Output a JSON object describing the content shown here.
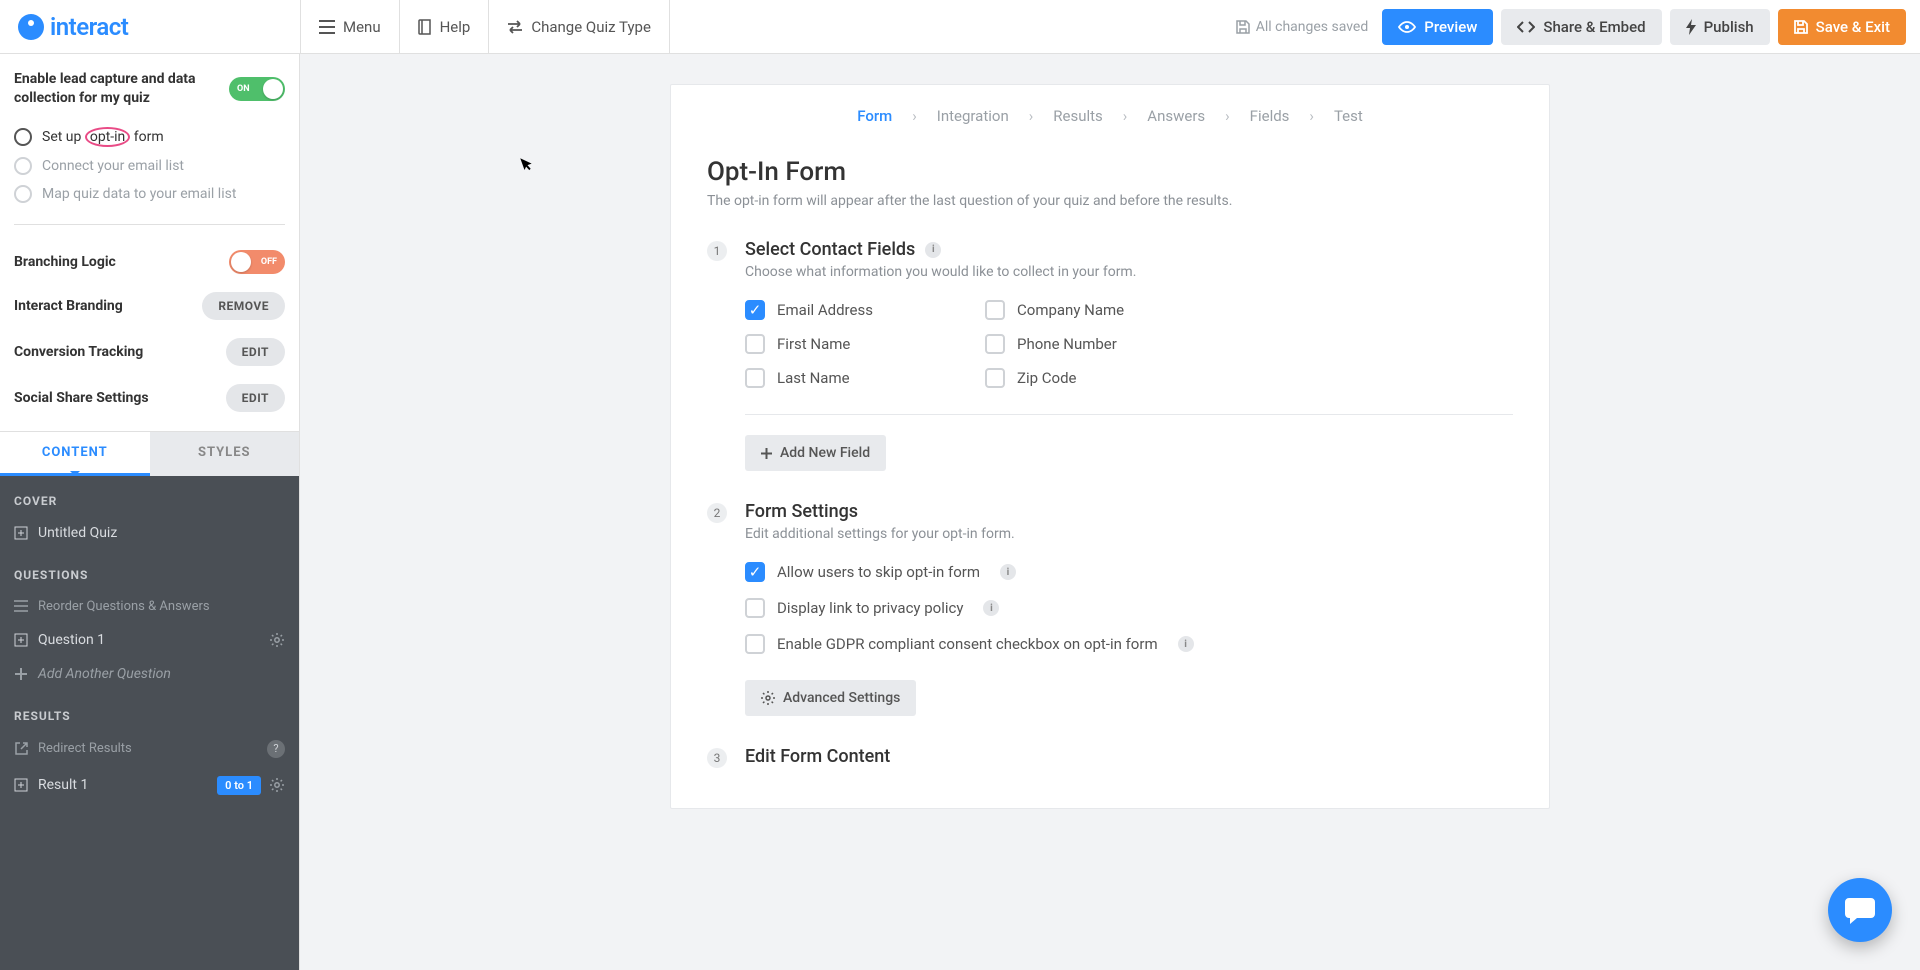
{
  "brand": "interact",
  "topbar": {
    "menu": "Menu",
    "help": "Help",
    "change": "Change Quiz Type",
    "status": "All changes saved",
    "preview": "Preview",
    "share": "Share & Embed",
    "publish": "Publish",
    "save": "Save & Exit"
  },
  "sidebar": {
    "lead_label": "Enable lead capture and data collection for my quiz",
    "lead_toggle": "ON",
    "steps": [
      "Set up ",
      "opt-in",
      " form",
      "Connect your email list",
      "Map quiz data to your email list"
    ],
    "branching": "Branching Logic",
    "branching_toggle": "OFF",
    "branding": "Interact Branding",
    "remove": "REMOVE",
    "conversion": "Conversion Tracking",
    "social": "Social Share Settings",
    "edit": "EDIT",
    "tab_content": "CONTENT",
    "tab_styles": "STYLES",
    "cover": "COVER",
    "untitled": "Untitled Quiz",
    "questions": "QUESTIONS",
    "reorder": "Reorder Questions & Answers",
    "q1": "Question 1",
    "add_q": "Add Another Question",
    "results": "RESULTS",
    "redirect": "Redirect Results",
    "r1": "Result 1",
    "r1_badge": "0 to 1"
  },
  "bc": [
    "Form",
    "Integration",
    "Results",
    "Answers",
    "Fields",
    "Test"
  ],
  "page": {
    "title": "Opt-In Form",
    "sub": "The opt-in form will appear after the last question of your quiz and before the results."
  },
  "s1": {
    "num": "1",
    "title": "Select Contact Fields",
    "sub": "Choose what information you would like to collect in your form.",
    "fields": [
      "Email Address",
      "Company Name",
      "First Name",
      "Phone Number",
      "Last Name",
      "Zip Code"
    ],
    "add": "Add New Field"
  },
  "s2": {
    "num": "2",
    "title": "Form Settings",
    "sub": "Edit additional settings for your opt-in form.",
    "opt_skip": "Allow users to skip opt-in form",
    "opt_priv": "Display link to privacy policy",
    "opt_gdpr": "Enable GDPR compliant consent checkbox on opt-in form",
    "adv": "Advanced Settings"
  },
  "s3": {
    "num": "3",
    "title": "Edit Form Content"
  }
}
